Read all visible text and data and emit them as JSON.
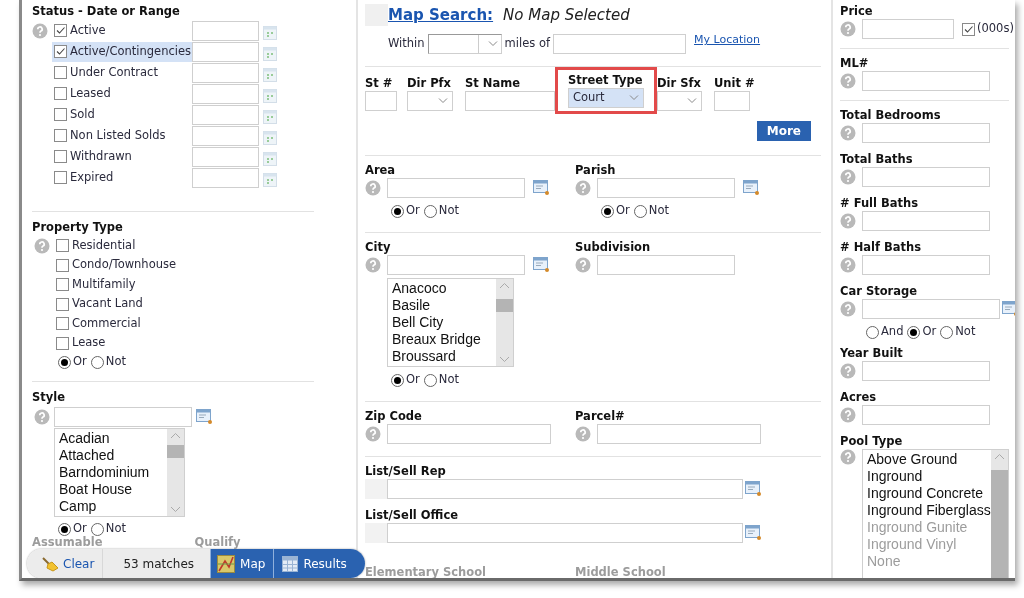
{
  "status_section": {
    "title": "Status - Date or Range",
    "items": [
      {
        "label": "Active",
        "checked": true,
        "selected": false
      },
      {
        "label": "Active/Contingencies",
        "checked": true,
        "selected": true
      },
      {
        "label": "Under Contract",
        "checked": false,
        "selected": false
      },
      {
        "label": "Leased",
        "checked": false,
        "selected": false
      },
      {
        "label": "Sold",
        "checked": false,
        "selected": false
      },
      {
        "label": "Non Listed Solds",
        "checked": false,
        "selected": false
      },
      {
        "label": "Withdrawn",
        "checked": false,
        "selected": false
      },
      {
        "label": "Expired",
        "checked": false,
        "selected": false
      }
    ]
  },
  "property_type": {
    "title": "Property Type",
    "items": [
      {
        "label": "Residential",
        "checked": false
      },
      {
        "label": "Condo/Townhouse",
        "checked": false
      },
      {
        "label": "Multifamily",
        "checked": false
      },
      {
        "label": "Vacant Land",
        "checked": false
      },
      {
        "label": "Commercial",
        "checked": false
      },
      {
        "label": "Lease",
        "checked": false
      }
    ],
    "logic": [
      {
        "label": "Or",
        "selected": true
      },
      {
        "label": "Not",
        "selected": false
      }
    ]
  },
  "style": {
    "title": "Style",
    "options": [
      "Acadian",
      "Attached",
      "Barndominium",
      "Boat House",
      "Camp"
    ],
    "logic": [
      {
        "label": "Or",
        "selected": true
      },
      {
        "label": "Not",
        "selected": false
      }
    ]
  },
  "left_faded_labels": [
    "Assumable",
    "Qualify"
  ],
  "action_bar": {
    "clear": "Clear",
    "matches": "53 matches",
    "map": "Map",
    "results": "Results"
  },
  "map_search": {
    "link": "Map Search:",
    "status": "No Map Selected",
    "within": "Within",
    "miles_of": "miles of",
    "my_location": "My Location"
  },
  "address": {
    "fields": [
      {
        "label": "St #",
        "kind": "text",
        "highlighted": false
      },
      {
        "label": "Dir Pfx",
        "kind": "select",
        "highlighted": false
      },
      {
        "label": "St Name",
        "kind": "text",
        "highlighted": false
      },
      {
        "label": "Street Type",
        "kind": "select",
        "value": "Court",
        "highlighted": true
      },
      {
        "label": "Dir Sfx",
        "kind": "select",
        "highlighted": false
      },
      {
        "label": "Unit #",
        "kind": "text",
        "highlighted": false
      }
    ],
    "more": "More"
  },
  "middle_sections": [
    {
      "rows": [
        [
          {
            "label": "Area",
            "kind": "lookup",
            "help": true,
            "logic": [
              {
                "label": "Or",
                "selected": true
              },
              {
                "label": "Not",
                "selected": false
              }
            ]
          },
          {
            "label": "Parish",
            "kind": "lookup",
            "help": true,
            "logic": [
              {
                "label": "Or",
                "selected": true
              },
              {
                "label": "Not",
                "selected": false
              }
            ]
          }
        ]
      ]
    },
    {
      "rows": [
        [
          {
            "label": "City",
            "kind": "lookup",
            "help": true,
            "options": [
              "Anacoco",
              "Basile",
              "Bell City",
              "Breaux Bridge",
              "Broussard"
            ],
            "logic": [
              {
                "label": "Or",
                "selected": true
              },
              {
                "label": "Not",
                "selected": false
              }
            ]
          },
          {
            "label": "Subdivision",
            "kind": "text",
            "help": true
          }
        ]
      ]
    },
    {
      "rows": [
        [
          {
            "label": "Zip Code",
            "kind": "text",
            "help": true
          },
          {
            "label": "Parcel#",
            "kind": "text",
            "help": true
          }
        ]
      ]
    },
    {
      "rows": [
        [
          {
            "label": "List/Sell Rep",
            "kind": "lookup",
            "help": false
          }
        ],
        [
          {
            "label": "List/Sell Office",
            "kind": "lookup",
            "help": false
          }
        ],
        [
          {
            "label": "Elementary School",
            "kind": "faded"
          },
          {
            "label": "Middle School",
            "kind": "faded"
          }
        ]
      ]
    }
  ],
  "right_sections": [
    [
      {
        "label": "Price",
        "kind": "text",
        "help": true,
        "unit_checkbox": {
          "label": "(000s)",
          "checked": true
        }
      }
    ],
    [
      {
        "label": "ML#",
        "kind": "text",
        "help": true
      }
    ],
    [
      {
        "label": "Total Bedrooms",
        "kind": "text",
        "help": true
      },
      {
        "label": "Total Baths",
        "kind": "text",
        "help": true
      },
      {
        "label": "# Full Baths",
        "kind": "text",
        "help": true
      },
      {
        "label": "# Half Baths",
        "kind": "text",
        "help": true
      },
      {
        "label": "Car Storage",
        "kind": "lookup",
        "help": true,
        "logic": [
          {
            "label": "And",
            "selected": false
          },
          {
            "label": "Or",
            "selected": true
          },
          {
            "label": "Not",
            "selected": false
          }
        ]
      },
      {
        "label": "Year Built",
        "kind": "text",
        "help": true
      },
      {
        "label": "Acres",
        "kind": "text",
        "help": true
      },
      {
        "label": "Pool Type",
        "kind": "list",
        "help": true,
        "options": [
          "Above Ground",
          "Inground",
          "Inground Concrete",
          "Inground Fiberglass"
        ],
        "faded_options": [
          "Inground Gunite",
          "Inground Vinyl",
          "None"
        ]
      }
    ]
  ]
}
